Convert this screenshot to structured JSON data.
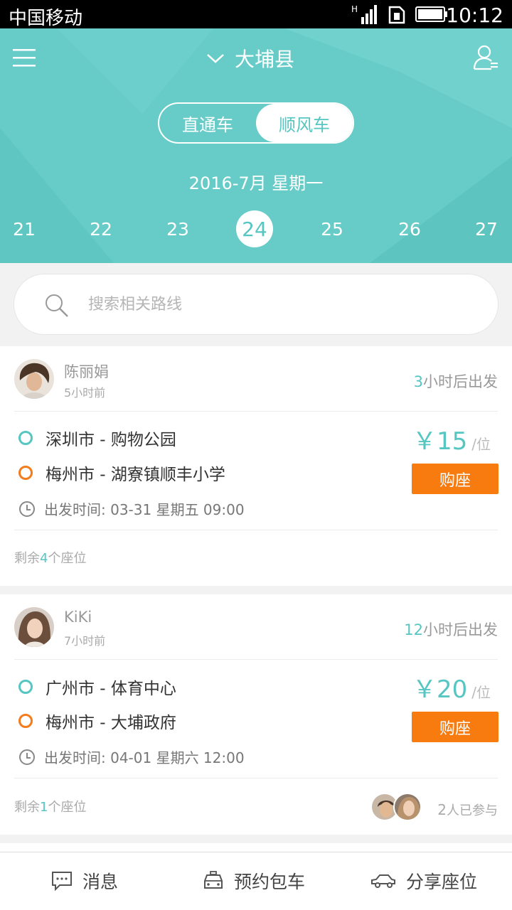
{
  "status_bar": {
    "carrier": "中国移动",
    "time": "10:12",
    "network": "H"
  },
  "header": {
    "city": "大埔县",
    "modes": [
      {
        "label": "直通车",
        "active": false
      },
      {
        "label": "顺风车",
        "active": true
      }
    ],
    "month_label": "2016-7月  星期一",
    "days": [
      "21",
      "22",
      "23",
      "24",
      "25",
      "26",
      "27"
    ],
    "selected_day": "24"
  },
  "search": {
    "placeholder": "搜索相关路线"
  },
  "trips": [
    {
      "name": "陈丽娟",
      "posted": "5小时前",
      "depart_hours": "3",
      "depart_suffix": "小时后出发",
      "from": "深圳市 - 购物公园",
      "to": "梅州市 - 湖寮镇顺丰小学",
      "time_label": "出发时间: 03-31  星期五  09:00",
      "price": "￥15",
      "price_unit": "/位",
      "buy_label": "购座",
      "seats_prefix": "剩余",
      "seats_left": "4",
      "seats_suffix": "个座位"
    },
    {
      "name": "KiKi",
      "posted": "7小时前",
      "depart_hours": "12",
      "depart_suffix": "小时后出发",
      "from": "广州市 - 体育中心",
      "to": "梅州市 - 大埔政府",
      "time_label": "出发时间: 04-01  星期六  12:00",
      "price": "￥20",
      "price_unit": "/位",
      "buy_label": "购座",
      "seats_prefix": "剩余",
      "seats_left": "1",
      "seats_suffix": "个座位",
      "joined_count": "2",
      "joined_suffix": "人已参与"
    }
  ],
  "tabbar": {
    "items": [
      {
        "label": "消息",
        "icon": "message-icon"
      },
      {
        "label": "预约包车",
        "icon": "taxi-icon"
      },
      {
        "label": "分享座位",
        "icon": "car-icon"
      }
    ]
  },
  "colors": {
    "accent": "#55c6c2",
    "header_bg": "#67ccc8",
    "buy_button": "#f77b0f",
    "destination_dot": "#f37c1c"
  }
}
